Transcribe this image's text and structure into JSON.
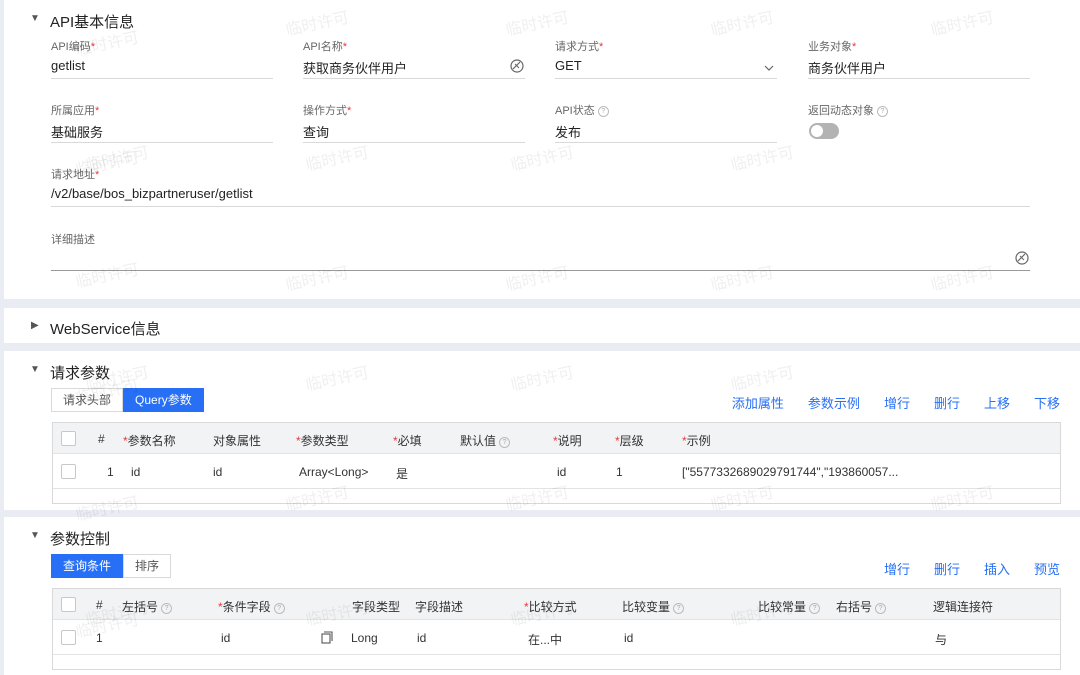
{
  "api_info": {
    "title": "API基本信息",
    "fields": {
      "code": {
        "label": "API编码",
        "value": "getlist"
      },
      "name": {
        "label": "API名称",
        "value": "获取商务伙伴用户"
      },
      "method": {
        "label": "请求方式",
        "value": "GET"
      },
      "business_object": {
        "label": "业务对象",
        "value": "商务伙伴用户"
      },
      "app": {
        "label": "所属应用",
        "value": "基础服务"
      },
      "operation": {
        "label": "操作方式",
        "value": "查询"
      },
      "status": {
        "label": "API状态",
        "value": "发布"
      },
      "return_dynamic": {
        "label": "返回动态对象"
      },
      "url": {
        "label": "请求地址",
        "value": "/v2/base/bos_bizpartneruser/getlist"
      },
      "description": {
        "label": "详细描述",
        "value": ""
      }
    }
  },
  "webservice": {
    "title": "WebService信息"
  },
  "request_params": {
    "title": "请求参数",
    "tabs": [
      "请求头部",
      "Query参数"
    ],
    "actions": [
      "添加属性",
      "参数示例",
      "增行",
      "删行",
      "上移",
      "下移"
    ],
    "columns": {
      "index": "#",
      "name": "参数名称",
      "attr": "对象属性",
      "type": "参数类型",
      "required": "必填",
      "default": "默认值",
      "desc": "说明",
      "level": "层级",
      "example": "示例"
    },
    "rows": [
      {
        "index": "1",
        "name": "id",
        "attr": "id",
        "type": "Array<Long>",
        "required": "是",
        "default": "",
        "desc": "id",
        "level": "1",
        "example": "[\"5577332689029791744\",\"193860057..."
      }
    ]
  },
  "param_control": {
    "title": "参数控制",
    "tabs": [
      "查询条件",
      "排序"
    ],
    "actions": [
      "增行",
      "删行",
      "插入",
      "预览"
    ],
    "columns": {
      "index": "#",
      "lparen": "左括号",
      "field": "条件字段",
      "field_type": "字段类型",
      "field_desc": "字段描述",
      "compare": "比较方式",
      "var": "比较变量",
      "const": "比较常量",
      "rparen": "右括号",
      "logic": "逻辑连接符"
    },
    "rows": [
      {
        "index": "1",
        "lparen": "",
        "field": "id",
        "field_type": "Long",
        "field_desc": "id",
        "compare": "在...中",
        "var": "id",
        "const": "",
        "rparen": "",
        "logic": "与"
      }
    ]
  },
  "watermark": "临时许可",
  "accent_color": "#276ff5"
}
